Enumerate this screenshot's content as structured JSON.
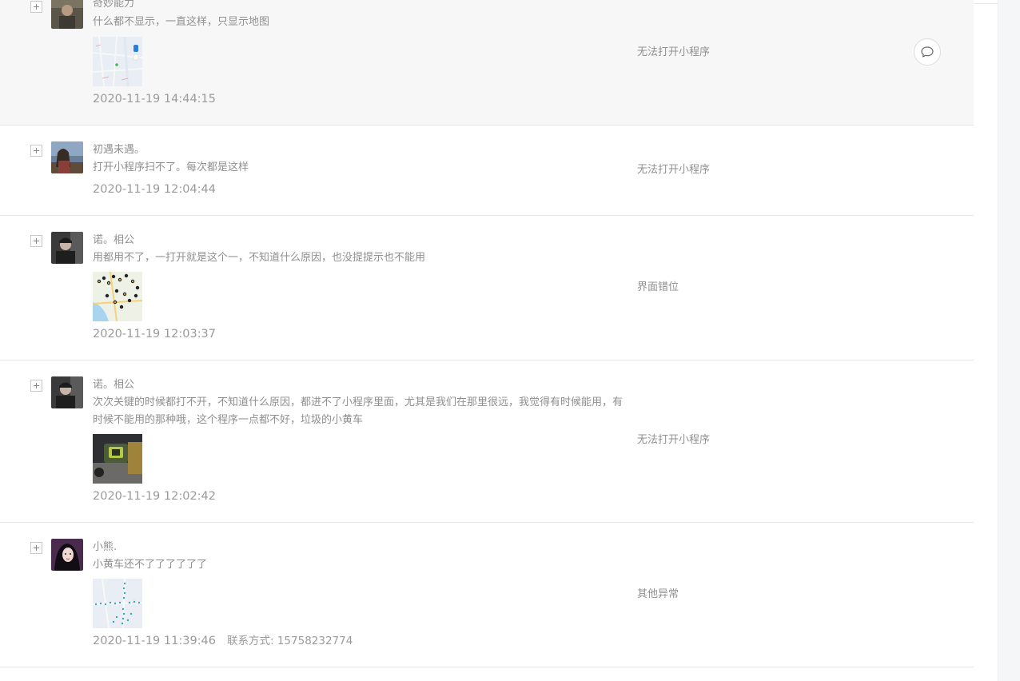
{
  "feedback_list": [
    {
      "user": "奇妙能力",
      "content": "什么都不显示，一直这样，只显示地图",
      "time": "2020-11-19 14:44:15",
      "category": "无法打开小程序",
      "has_image": true,
      "image_icon": "map-screenshot-thumbnail",
      "has_reply_button": true
    },
    {
      "user": "初遇未遇。",
      "content": "打开小程序扫不了。每次都是这样",
      "time": "2020-11-19 12:04:44",
      "category": "无法打开小程序",
      "has_image": false
    },
    {
      "user": "诺。相公",
      "content": "用都用不了，一打开就是这个一，不知道什么原因，也没提提示也不能用",
      "time": "2020-11-19 12:03:37",
      "category": "界面错位",
      "has_image": true,
      "image_icon": "map-with-bike-markers-thumbnail"
    },
    {
      "user": "诺。相公",
      "content": "次次关键的时候都打不开，不知道什么原因，都进不了小程序里面，尤其是我们在那里很远，我觉得有时候能用，有时候不能用的那种哦，这个程序一点都不好，垃圾的小黄车",
      "time": "2020-11-19 12:02:42",
      "category": "无法打开小程序",
      "has_image": true,
      "image_icon": "bike-lock-photo-thumbnail"
    },
    {
      "user": "小熊.",
      "content": "小黄车还不了了了了了了",
      "time": "2020-11-19 11:39:46",
      "contact_label": "联系方式: 15758232774",
      "category": "其他异常",
      "has_image": true,
      "image_icon": "map-dotted-route-thumbnail"
    }
  ],
  "colors": {
    "active_row_bg": "#f7f7f7",
    "border": "#e6e6e6",
    "text": "#8f8f8f"
  }
}
